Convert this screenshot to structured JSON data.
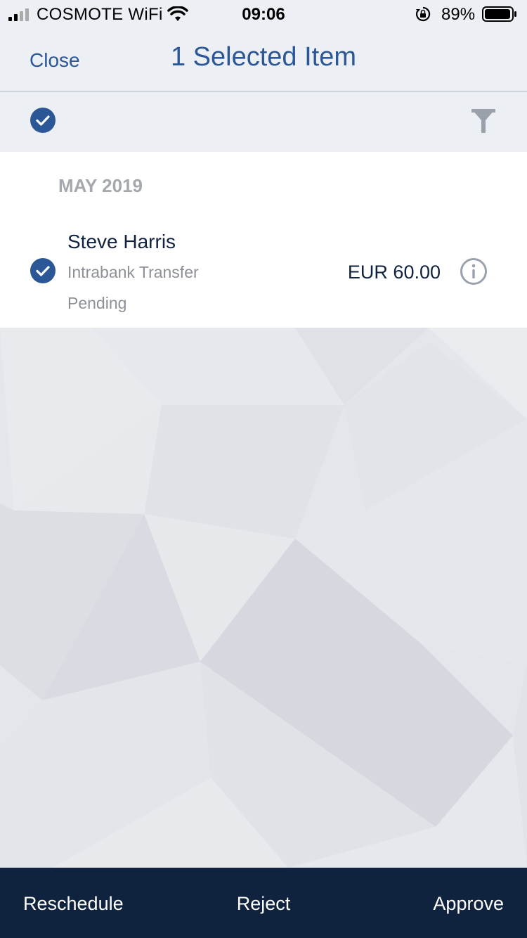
{
  "status_bar": {
    "carrier": "COSMOTE WiFi",
    "time": "09:06",
    "battery_percent": "89%",
    "icons": [
      "signal-icon",
      "wifi-icon",
      "rotation-lock-icon",
      "battery-icon"
    ]
  },
  "header": {
    "close_label": "Close",
    "title": "1 Selected Item"
  },
  "toolbar": {
    "icons": [
      "select-all-check-icon",
      "filter-icon"
    ]
  },
  "list": {
    "section_header": "MAY 2019",
    "items": [
      {
        "payee": "Steve Harris",
        "type": "Intrabank Transfer",
        "status": "Pending",
        "amount": "EUR 60.00"
      }
    ]
  },
  "actions": {
    "reschedule": "Reschedule",
    "reject": "Reject",
    "approve": "Approve"
  },
  "colors": {
    "accent": "#2b5797",
    "action_bar": "#0f223e",
    "nav_background": "#eceff3",
    "muted_text": "#8c9097"
  }
}
